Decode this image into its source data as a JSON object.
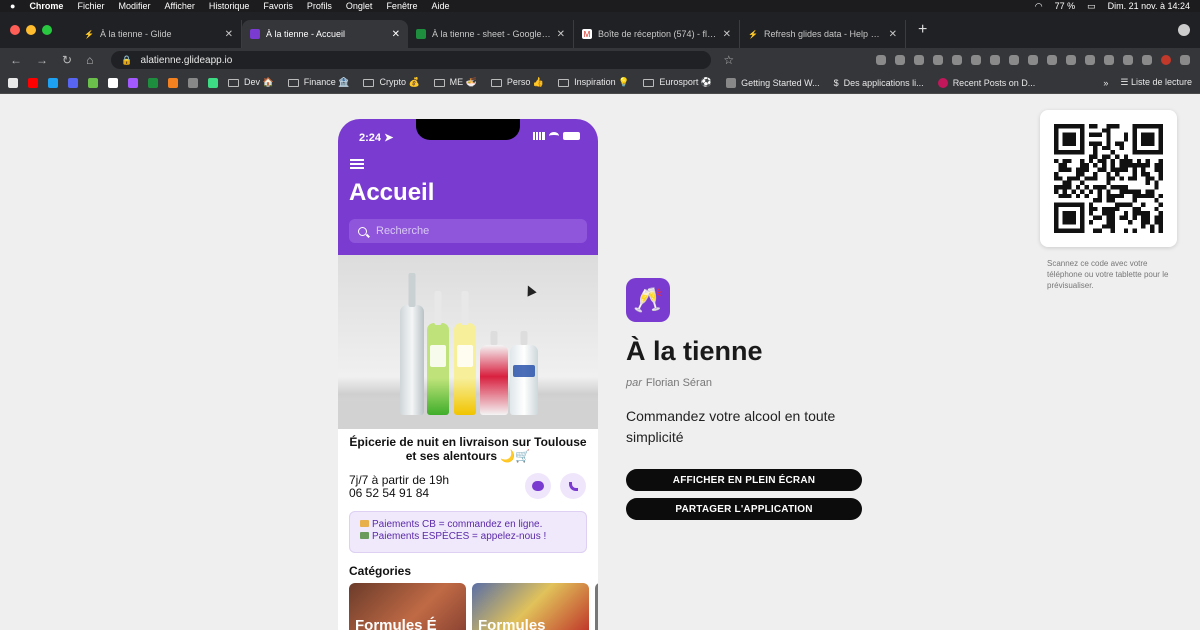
{
  "menubar": {
    "app": "Chrome",
    "items": [
      "Fichier",
      "Modifier",
      "Afficher",
      "Historique",
      "Favoris",
      "Profils",
      "Onglet",
      "Fenêtre",
      "Aide"
    ],
    "battery": "77 %",
    "datetime": "Dim. 21 nov. à 14:24"
  },
  "tabs": [
    {
      "title": "À la tienne - Glide",
      "icon": "glide-icon"
    },
    {
      "title": "À la tienne - Accueil",
      "icon": "app-icon",
      "active": true
    },
    {
      "title": "À la tienne - sheet - Google Sh",
      "icon": "sheets-icon"
    },
    {
      "title": "Boîte de réception (574) - flosé",
      "icon": "gmail-icon"
    },
    {
      "title": "Refresh glides data - Help & Ho",
      "icon": "glide-icon"
    }
  ],
  "address": {
    "url": "alatienne.glideapp.io"
  },
  "bookmarks": {
    "folders": [
      "Dev 🏠",
      "Finance 🏦",
      "Crypto 💰",
      "ME 🍜",
      "Perso 👍",
      "Inspiration 💡",
      "Eurosport ⚽"
    ],
    "links": [
      "Getting Started W...",
      "Des applications li...",
      "Recent Posts on D..."
    ],
    "more": "»",
    "reading_list": "Liste de lecture"
  },
  "phone": {
    "time": "2:24",
    "title": "Accueil",
    "search_placeholder": "Recherche",
    "shop_title": "Épicerie de nuit en livraison sur Toulouse et ses alentours 🌙🛒",
    "hours": "7j/7 à partir de 19h",
    "phone_number": "06 52 54 91 84",
    "notice_line1": "Paiements CB = commandez en ligne.",
    "notice_line2": "Paiements ESPÈCES = appelez-nous !",
    "categories_heading": "Catégories",
    "categories": [
      "Formules É",
      "Formules"
    ]
  },
  "app": {
    "name": "À la tienne",
    "author_prefix": "par",
    "author": "Florian Séran",
    "description": "Commandez votre alcool en toute simplicité",
    "fullscreen_button": "AFFICHER EN PLEIN ÉCRAN",
    "share_button": "PARTAGER L'APPLICATION"
  },
  "qr": {
    "note": "Scannez ce code avec votre téléphone ou votre tablette pour le prévisualiser."
  },
  "colors": {
    "accent": "#7a3bd0",
    "button": "#0c0c0c",
    "background": "#efefef"
  }
}
